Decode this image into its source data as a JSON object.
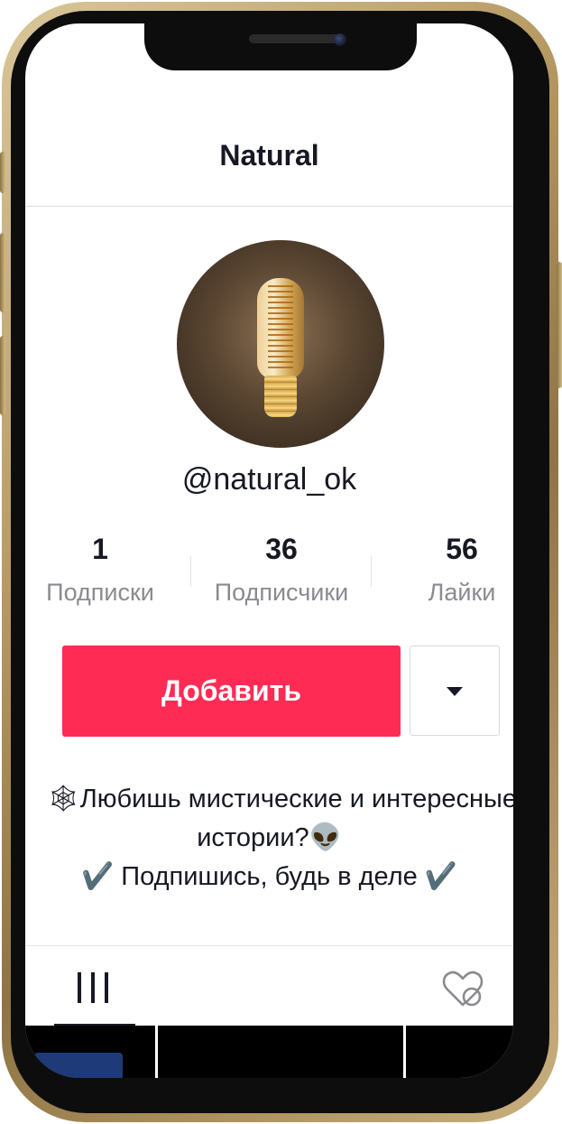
{
  "header": {
    "title": "Natural"
  },
  "profile": {
    "handle": "@natural_ok",
    "avatar_icon": "edison-bulb-avatar"
  },
  "stats": [
    {
      "value": "1",
      "label": "Подписки"
    },
    {
      "value": "36",
      "label": "Подписчики"
    },
    {
      "value": "56",
      "label": "Лайки"
    }
  ],
  "actions": {
    "add_label": "Добавить",
    "more_icon": "caret-down-icon",
    "accent_color": "#fe2c55"
  },
  "bio": {
    "line1": "🕸Любишь мистические и интересные",
    "line2": "истории?👽",
    "line3": "✔️ Подпишись, будь в деле ✔️"
  },
  "tabs": [
    {
      "icon": "grid-icon",
      "active": true
    },
    {
      "icon": "liked-hidden-icon",
      "active": false
    }
  ]
}
